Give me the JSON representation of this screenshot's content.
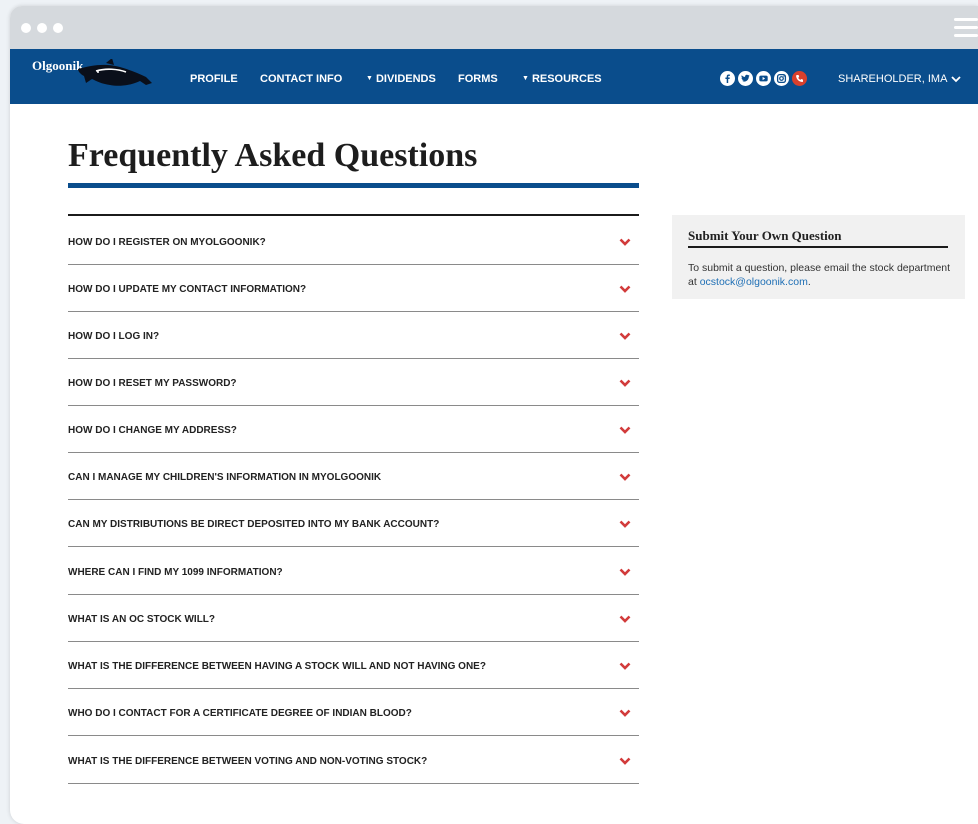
{
  "nav": {
    "logo": "Olgoonik",
    "links": [
      "PROFILE",
      "CONTACT INFO",
      "DIVIDENDS",
      "FORMS",
      "RESOURCES"
    ],
    "social_icons": [
      "facebook-icon",
      "twitter-icon",
      "youtube-icon",
      "instagram-icon",
      "phone-icon"
    ],
    "user": "SHAREHOLDER, IMA"
  },
  "main": {
    "title": "Frequently Asked Questions",
    "faqs": [
      "HOW DO I REGISTER ON MYOLGOONIK?",
      "HOW DO I UPDATE MY CONTACT INFORMATION?",
      "HOW DO I LOG IN?",
      "HOW DO I RESET MY PASSWORD?",
      "HOW DO I CHANGE MY ADDRESS?",
      "CAN I MANAGE MY CHILDREN'S INFORMATION IN MYOLGOONIK",
      "CAN MY DISTRIBUTIONS BE DIRECT DEPOSITED INTO MY BANK ACCOUNT?",
      "WHERE CAN I FIND MY 1099 INFORMATION?",
      "WHAT IS AN OC STOCK WILL?",
      "WHAT IS THE DIFFERENCE BETWEEN HAVING A STOCK WILL AND NOT HAVING ONE?",
      "WHO DO I CONTACT FOR A CERTIFICATE DEGREE OF INDIAN BLOOD?",
      "WHAT IS THE DIFFERENCE BETWEEN VOTING AND NON-VOTING STOCK?"
    ]
  },
  "sidebar": {
    "title": "Submit Your Own Question",
    "text": "To submit a question, please email the stock department at ",
    "email": "ocstock@olgoonik.com",
    "text_end": "."
  },
  "colors": {
    "nav_bg": "#0a4d8c",
    "chevron": "#d23b3b",
    "phone": "#d9402c",
    "link": "#1f6fb5"
  }
}
